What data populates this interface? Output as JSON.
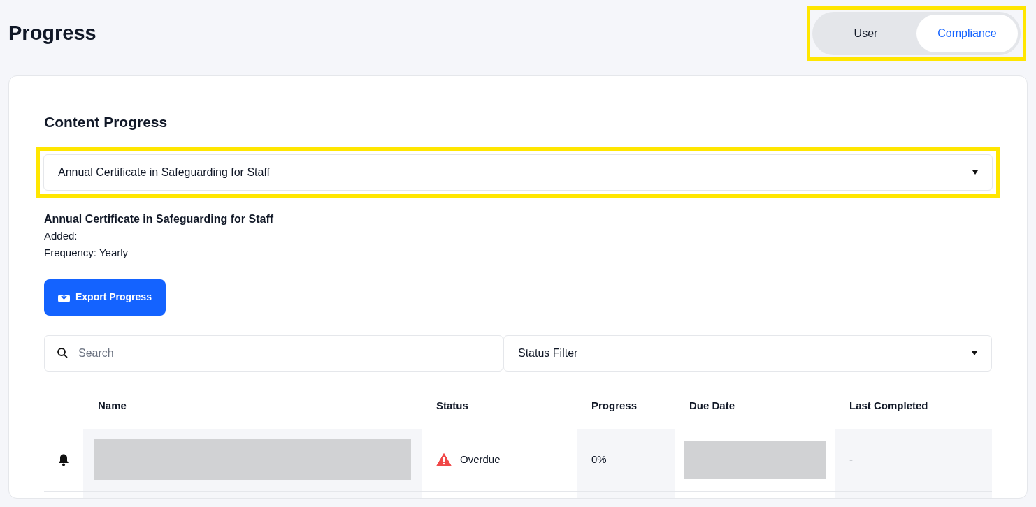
{
  "page_title": "Progress",
  "view_toggle": [
    {
      "label": "User",
      "selected": false
    },
    {
      "label": "Compliance",
      "selected": true
    }
  ],
  "section_title": "Content Progress",
  "content_select": {
    "value": "Annual Certificate in Safeguarding for Staff"
  },
  "content_info": {
    "title": "Annual Certificate in Safeguarding for Staff",
    "added": "Added:",
    "frequency": "Frequency: Yearly"
  },
  "export_button": "Export Progress",
  "search": {
    "placeholder": "Search"
  },
  "status_filter": {
    "value": "Status Filter"
  },
  "table": {
    "columns": [
      "Name",
      "Status",
      "Progress",
      "Due Date",
      "Last Completed"
    ],
    "rows": [
      {
        "reminder": true,
        "status": {
          "kind": "overdue",
          "label": "Overdue"
        },
        "progress": "0%",
        "last_completed": "-"
      }
    ]
  }
}
